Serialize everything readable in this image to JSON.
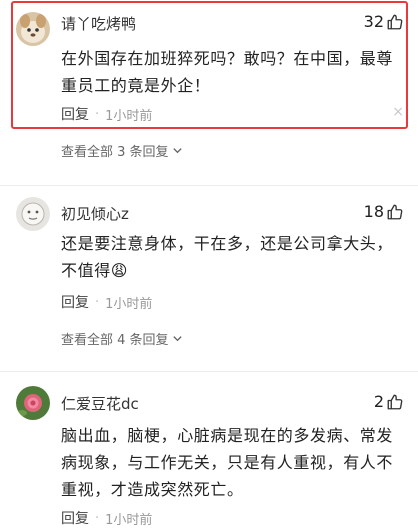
{
  "comments": [
    {
      "username": "请丫吃烤鸭",
      "likes": "32",
      "text": "在外国存在加班猝死吗？敢吗？在中国，最尊重员工的竟是外企！",
      "reply_label": "回复",
      "separator": "·",
      "time": "1小时前",
      "close": "×",
      "view_all": "查看全部 3 条回复"
    },
    {
      "username": "初见倾心z",
      "likes": "18",
      "text": "还是要注意身体，干在多，还是公司拿大头，不值得😩",
      "reply_label": "回复",
      "separator": "·",
      "time": "1小时前",
      "view_all": "查看全部 4 条回复"
    },
    {
      "username": "仁爱豆花dc",
      "likes": "2",
      "text": "脑出血，脑梗，心脏病是现在的多发病、常发病现象，与工作无关，只是有人重视，有人不重视，才造成突然死亡。",
      "reply_label": "回复",
      "separator": "·",
      "time": "1小时前"
    }
  ],
  "colors": {
    "highlight_border": "#e83a3a",
    "text": "#222222",
    "meta": "#999999"
  },
  "icons": {
    "like": "thumbs-up-icon",
    "chevron": "chevron-down-icon",
    "close": "close-icon"
  }
}
